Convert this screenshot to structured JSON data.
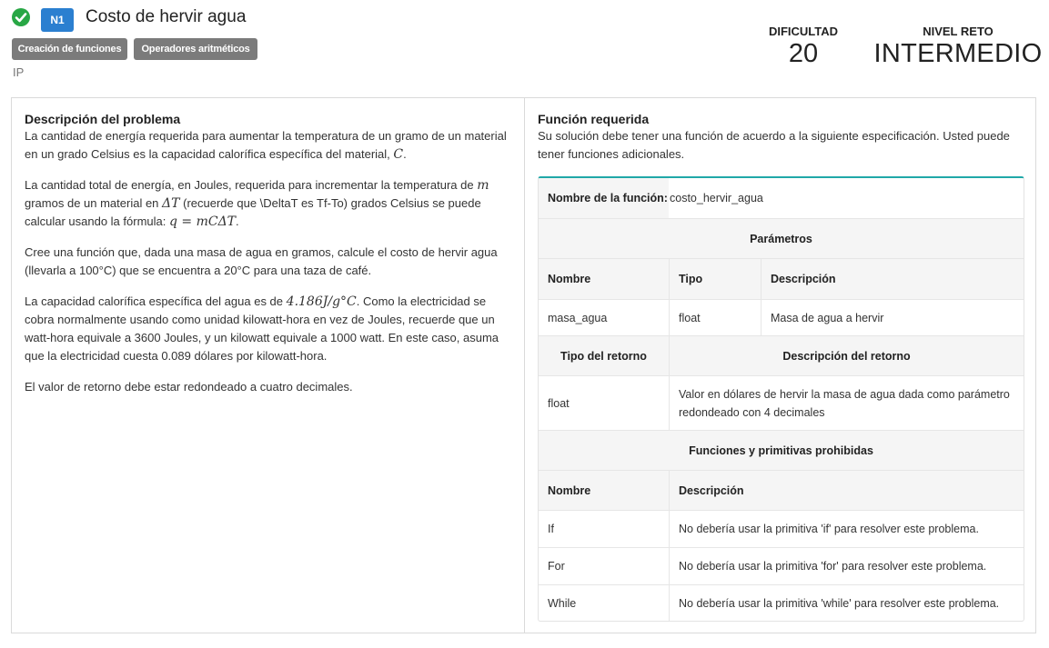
{
  "header": {
    "title": "Costo de hervir agua",
    "level_badge": "N1",
    "tags": [
      "Creación de funciones",
      "Operadores aritméticos"
    ],
    "course": "IP",
    "difficulty_label": "DIFICULTAD",
    "difficulty_value": "20",
    "challenge_label": "NIVEL RETO",
    "challenge_value": "INTERMEDIO",
    "status_color": "#28a745",
    "badge_color": "#2b7fd0"
  },
  "description": {
    "heading": "Descripción del problema",
    "p1": "La cantidad de energía requerida para aumentar la temperatura de un gramo de un material en un grado Celsius es la capacidad calorífica específica del material,",
    "p1_math": "C",
    "p2a": "La cantidad total de energía, en Joules, requerida para incrementar la temperatura de",
    "p2_m": "m",
    "p2b": "gramos de un material en",
    "p2_delta": "ΔT",
    "p2c": "(recuerde que \\DeltaT es Tf-To) grados Celsius se puede calcular usando la fórmula:",
    "p2_formula": "q = mCΔT",
    "p3": "Cree una función que, dada una masa de agua en gramos, calcule el costo de hervir agua (llevarla a 100°C) que se encuentra a 20°C para una taza de café.",
    "p4a": "La capacidad calorífica específica del agua es de",
    "p4_math": "4.186J/g°C",
    "p4b": "Como la electricidad se cobra normalmente usando como unidad kilowatt-hora en vez de Joules, recuerde que un watt-hora equivale a 3600 Joules, y un kilowatt equivale a 1000 watt. En este caso, asuma que la electricidad cuesta 0.089 dólares por kilowatt-hora.",
    "p5": "El valor de retorno debe estar redondeado a cuatro decimales."
  },
  "function_spec": {
    "heading": "Función requerida",
    "intro": "Su solución debe tener una función de acuerdo a la siguiente especificación. Usted puede tener funciones adicionales.",
    "name_label": "Nombre de la función:",
    "name_value": "costo_hervir_agua",
    "params_heading": "Parámetros",
    "params_columns": [
      "Nombre",
      "Tipo",
      "Descripción"
    ],
    "params": [
      {
        "name": "masa_agua",
        "type": "float",
        "description": "Masa de agua a hervir"
      }
    ],
    "return_type_label": "Tipo del retorno",
    "return_desc_label": "Descripción del retorno",
    "return_type": "float",
    "return_desc": "Valor en dólares de hervir la masa de agua dada como parámetro redondeado con 4 decimales",
    "forbidden_heading": "Funciones y primitivas prohibidas",
    "forbidden_columns": [
      "Nombre",
      "Descripción"
    ],
    "forbidden": [
      {
        "name": "If",
        "description": "No debería usar la primitiva 'if' para resolver este problema."
      },
      {
        "name": "For",
        "description": "No debería usar la primitiva 'for' para resolver este problema."
      },
      {
        "name": "While",
        "description": "No debería usar la primitiva 'while' para resolver este problema."
      }
    ],
    "accent_color": "#20a8a8"
  }
}
